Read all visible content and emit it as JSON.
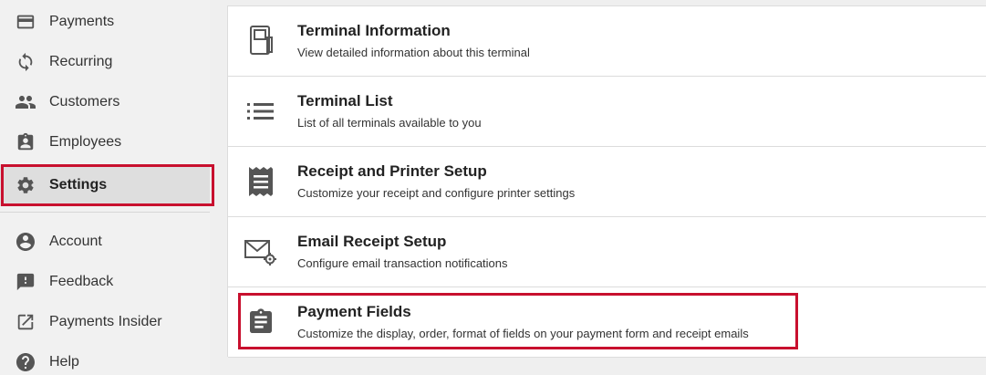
{
  "sidebar": {
    "items": [
      {
        "label": "Payments",
        "icon": "credit-card-icon"
      },
      {
        "label": "Recurring",
        "icon": "sync-icon"
      },
      {
        "label": "Customers",
        "icon": "people-icon"
      },
      {
        "label": "Employees",
        "icon": "badge-icon"
      },
      {
        "label": "Settings",
        "icon": "gear-icon",
        "active": true
      },
      {
        "label": "Account",
        "icon": "account-circle-icon"
      },
      {
        "label": "Feedback",
        "icon": "feedback-icon"
      },
      {
        "label": "Payments Insider",
        "icon": "external-link-icon"
      },
      {
        "label": "Help",
        "icon": "help-icon"
      }
    ]
  },
  "settings": {
    "cards": [
      {
        "title": "Terminal Information",
        "description": "View detailed information about this terminal",
        "icon": "terminal-icon"
      },
      {
        "title": "Terminal List",
        "description": "List of all terminals available to you",
        "icon": "list-icon"
      },
      {
        "title": "Receipt and Printer Setup",
        "description": "Customize your receipt and configure printer settings",
        "icon": "receipt-icon"
      },
      {
        "title": "Email Receipt Setup",
        "description": "Configure email transaction notifications",
        "icon": "email-settings-icon"
      },
      {
        "title": "Payment Fields",
        "description": "Customize the display, order, format of fields on your payment form and receipt emails",
        "icon": "clipboard-icon"
      }
    ]
  },
  "colors": {
    "highlight": "#c8102e",
    "icon": "#555555",
    "sidebar_bg": "#f1f1f1",
    "active_bg": "#dedede"
  }
}
